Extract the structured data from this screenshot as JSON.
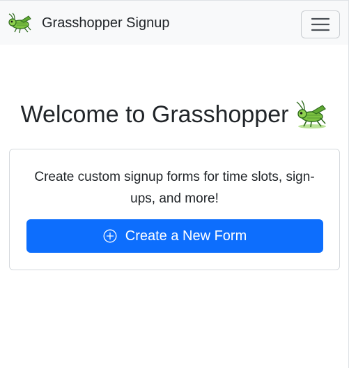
{
  "navbar": {
    "brand_text": "Grasshopper Signup",
    "brand_icon": "grasshopper-icon",
    "toggler_icon": "hamburger-menu-icon"
  },
  "hero": {
    "title": "Welcome to Grasshopper",
    "title_icon": "grasshopper-icon"
  },
  "card": {
    "description": "Create custom signup forms for time slots, sign-ups, and more!",
    "button_label": "Create a New Form",
    "button_icon": "plus-circle-icon"
  },
  "colors": {
    "primary": "#0d6efd",
    "navbar_bg": "#f8f9fa",
    "text": "#212529",
    "border": "#dee2e6"
  }
}
